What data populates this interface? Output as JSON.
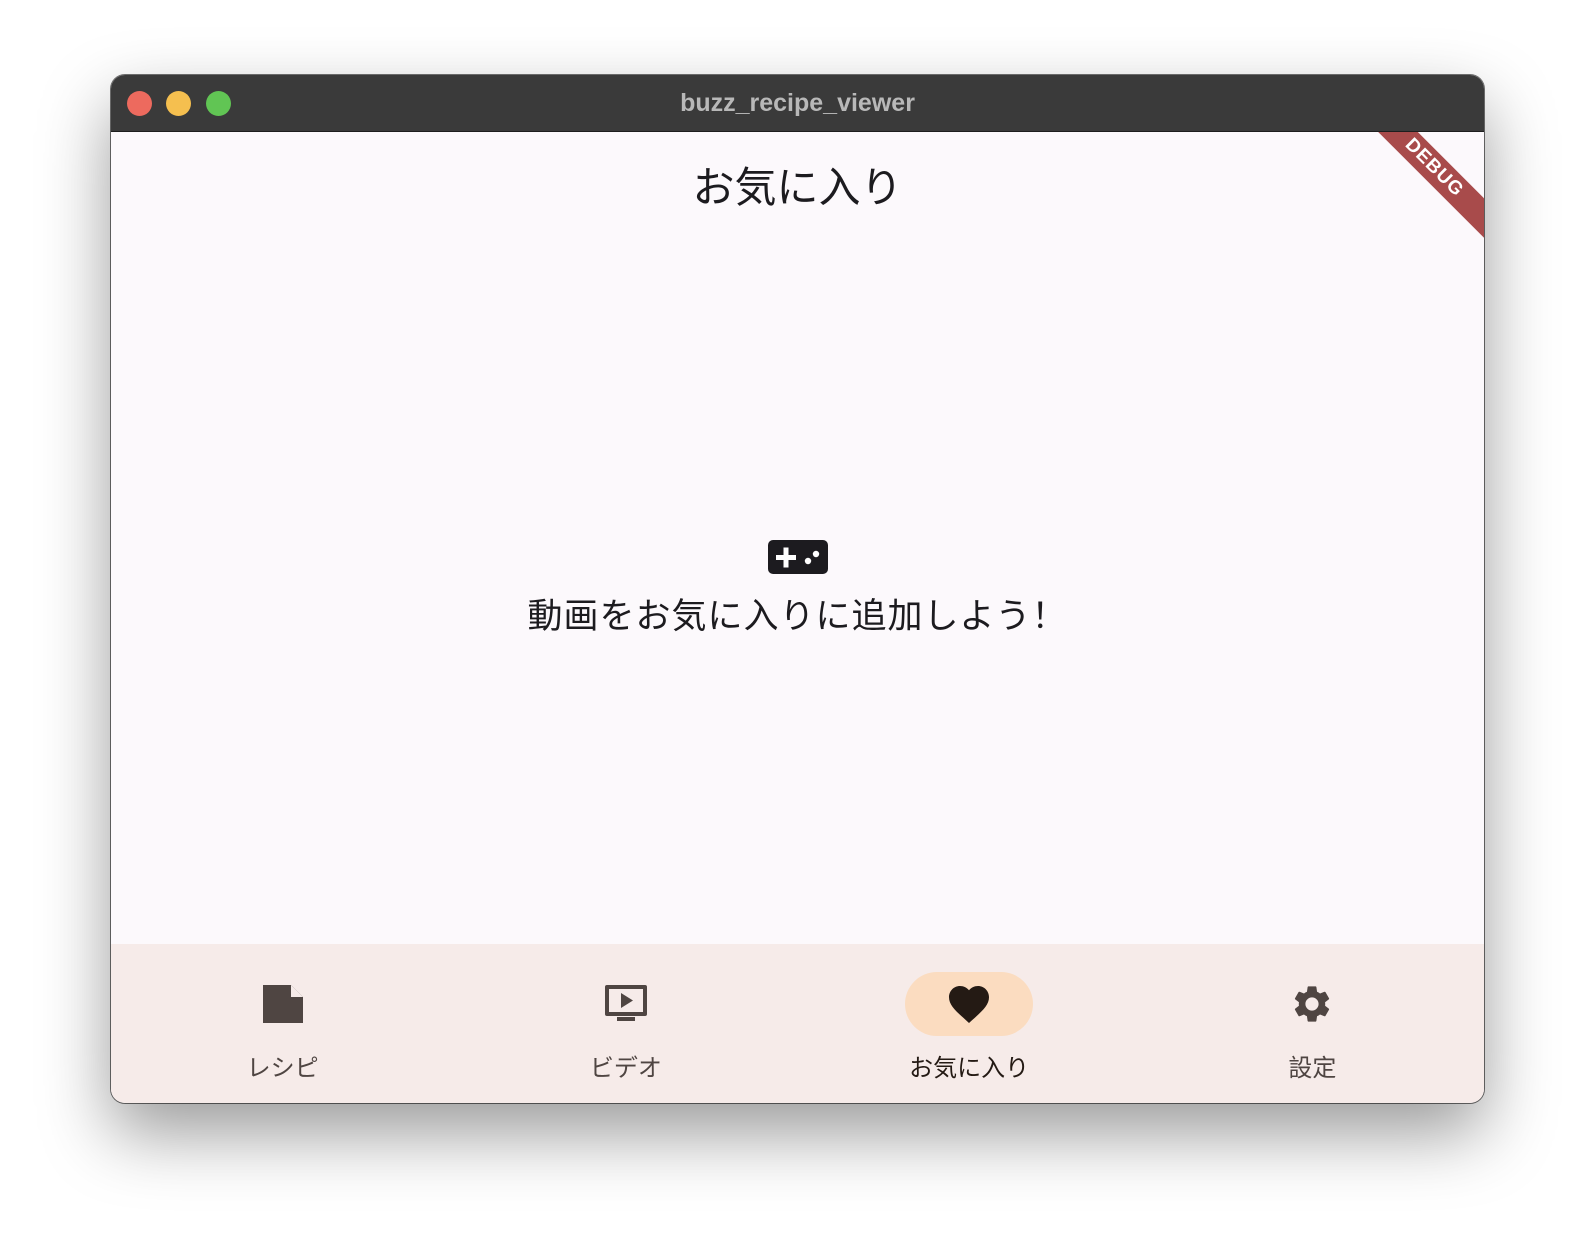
{
  "window": {
    "title": "buzz_recipe_viewer"
  },
  "appbar": {
    "title": "お気に入り"
  },
  "debug_banner": {
    "label": "DEBUG",
    "color": "#a84b4b"
  },
  "empty_state": {
    "icon": "gamepad-icon",
    "message": "動画をお気に入りに追加しよう！"
  },
  "bottom_nav": {
    "selected_index": 2,
    "indicator_color": "#fbdcc0",
    "items": [
      {
        "label": "レシピ",
        "icon": "note-icon"
      },
      {
        "label": "ビデオ",
        "icon": "tv-play-icon"
      },
      {
        "label": "お気に入り",
        "icon": "heart-icon"
      },
      {
        "label": "設定",
        "icon": "gear-icon"
      }
    ]
  }
}
